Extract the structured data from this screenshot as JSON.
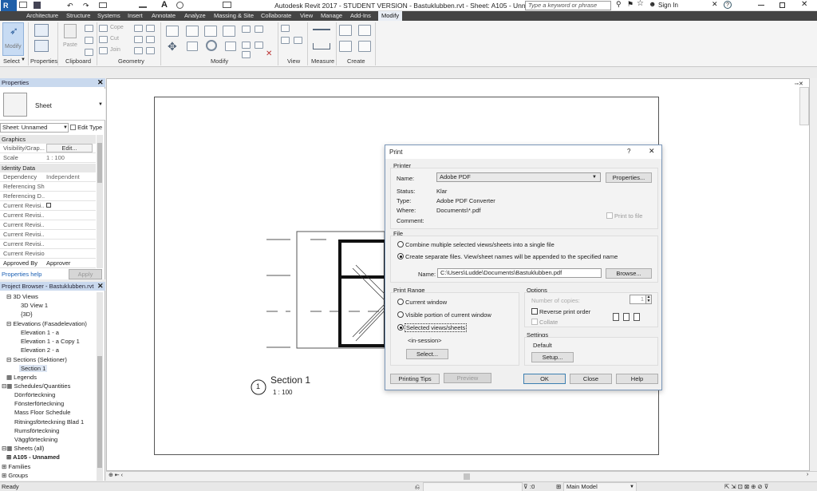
{
  "app": {
    "title": "Autodesk Revit 2017 - STUDENT VERSION -     Bastuklubben.rvt - Sheet: A105 - Unnamed",
    "search_placeholder": "Type a keyword or phrase",
    "sign_in": "Sign In",
    "logo": "R"
  },
  "tabs": [
    "Architecture",
    "Structure",
    "Systems",
    "Insert",
    "Annotate",
    "Analyze",
    "Massing & Site",
    "Collaborate",
    "View",
    "Manage",
    "Add-Ins",
    "Modify"
  ],
  "ribbon": {
    "modify": "Modify",
    "panels": {
      "select": "Select",
      "properties": "Properties",
      "clipboard": "Clipboard",
      "geometry": "Geometry",
      "modify": "Modify",
      "view": "View",
      "measure": "Measure",
      "create": "Create"
    },
    "paste": "Paste",
    "cope": "Cope",
    "cut": "Cut",
    "join": "Join"
  },
  "properties": {
    "header": "Properties",
    "type_name": "Sheet",
    "selector": "Sheet: Unnamed",
    "edit_type": "Edit Type",
    "groups": {
      "graphics": "Graphics",
      "identity": "Identity Data"
    },
    "rows": [
      {
        "k": "Visibility/Grap...",
        "v": "Edit..."
      },
      {
        "k": "Scale",
        "v": "1 : 100"
      },
      {
        "k": "Dependency",
        "v": "Independent"
      },
      {
        "k": "Referencing Sh...",
        "v": ""
      },
      {
        "k": "Referencing D...",
        "v": ""
      },
      {
        "k": "Current Revisi...",
        "v": ""
      },
      {
        "k": "Current Revisi...",
        "v": ""
      },
      {
        "k": "Current Revisi...",
        "v": ""
      },
      {
        "k": "Current Revisi...",
        "v": ""
      },
      {
        "k": "Current Revisi...",
        "v": ""
      },
      {
        "k": "Current Revision",
        "v": ""
      },
      {
        "k": "Approved By",
        "v": "Approver"
      }
    ],
    "help": "Properties help",
    "apply": "Apply"
  },
  "browser": {
    "header": "Project Browser - Bastuklubben.rvt",
    "items": [
      "3D Views",
      "3D View 1",
      "{3D}",
      "Elevations (Fasadelevation)",
      "Elevation 1 - a",
      "Elevation 1 - a Copy 1",
      "Elevation 2 - a",
      "Sections (Sektioner)",
      "Section 1",
      "Legends",
      "Schedules/Quantities",
      "Dörrförteckning",
      "Fönsterförteckning",
      "Mass Floor Schedule",
      "Ritningsförteckning Blad 1",
      "Rumsförteckning",
      "Väggförteckning",
      "Sheets (all)",
      "A105 - Unnamed",
      "Families",
      "Groups"
    ]
  },
  "drawing": {
    "section_title": "Section 1",
    "section_scale": "1 : 100",
    "section_number": "1"
  },
  "print": {
    "title": "Print",
    "help": "?",
    "close": "✕",
    "printer_group": "Printer",
    "name_label": "Name:",
    "name_value": "Adobe PDF",
    "properties_btn": "Properties...",
    "status_label": "Status:",
    "status_value": "Klar",
    "type_label": "Type:",
    "type_value": "Adobe PDF Converter",
    "where_label": "Where:",
    "where_value": "Documents\\*.pdf",
    "comment_label": "Comment:",
    "print_to_file": "Print to file",
    "file_group": "File",
    "combine": "Combine multiple selected views/sheets into a single file",
    "separate": "Create separate files. View/sheet names will be appended to the specified name",
    "file_name_label": "Name:",
    "file_name_value": "C:\\Users\\Ludde\\Documents\\Bastuklubben.pdf",
    "browse": "Browse...",
    "range_group": "Print Range",
    "current_window": "Current window",
    "visible_portion": "Visible portion of current window",
    "selected_views": "Selected views/sheets",
    "in_session": "<in-session>",
    "select_btn": "Select...",
    "options_group": "Options",
    "copies_label": "Number of copies:",
    "copies_value": "1",
    "reverse": "Reverse print order",
    "collate": "Collate",
    "settings_group": "Settings",
    "settings_value": "Default",
    "setup_btn": "Setup...",
    "printing_tips": "Printing Tips",
    "preview": "Preview",
    "ok": "OK",
    "close_btn": "Close",
    "help_btn": "Help"
  },
  "status": {
    "ready": "Ready",
    "filter": ":0",
    "model": "Main Model"
  }
}
